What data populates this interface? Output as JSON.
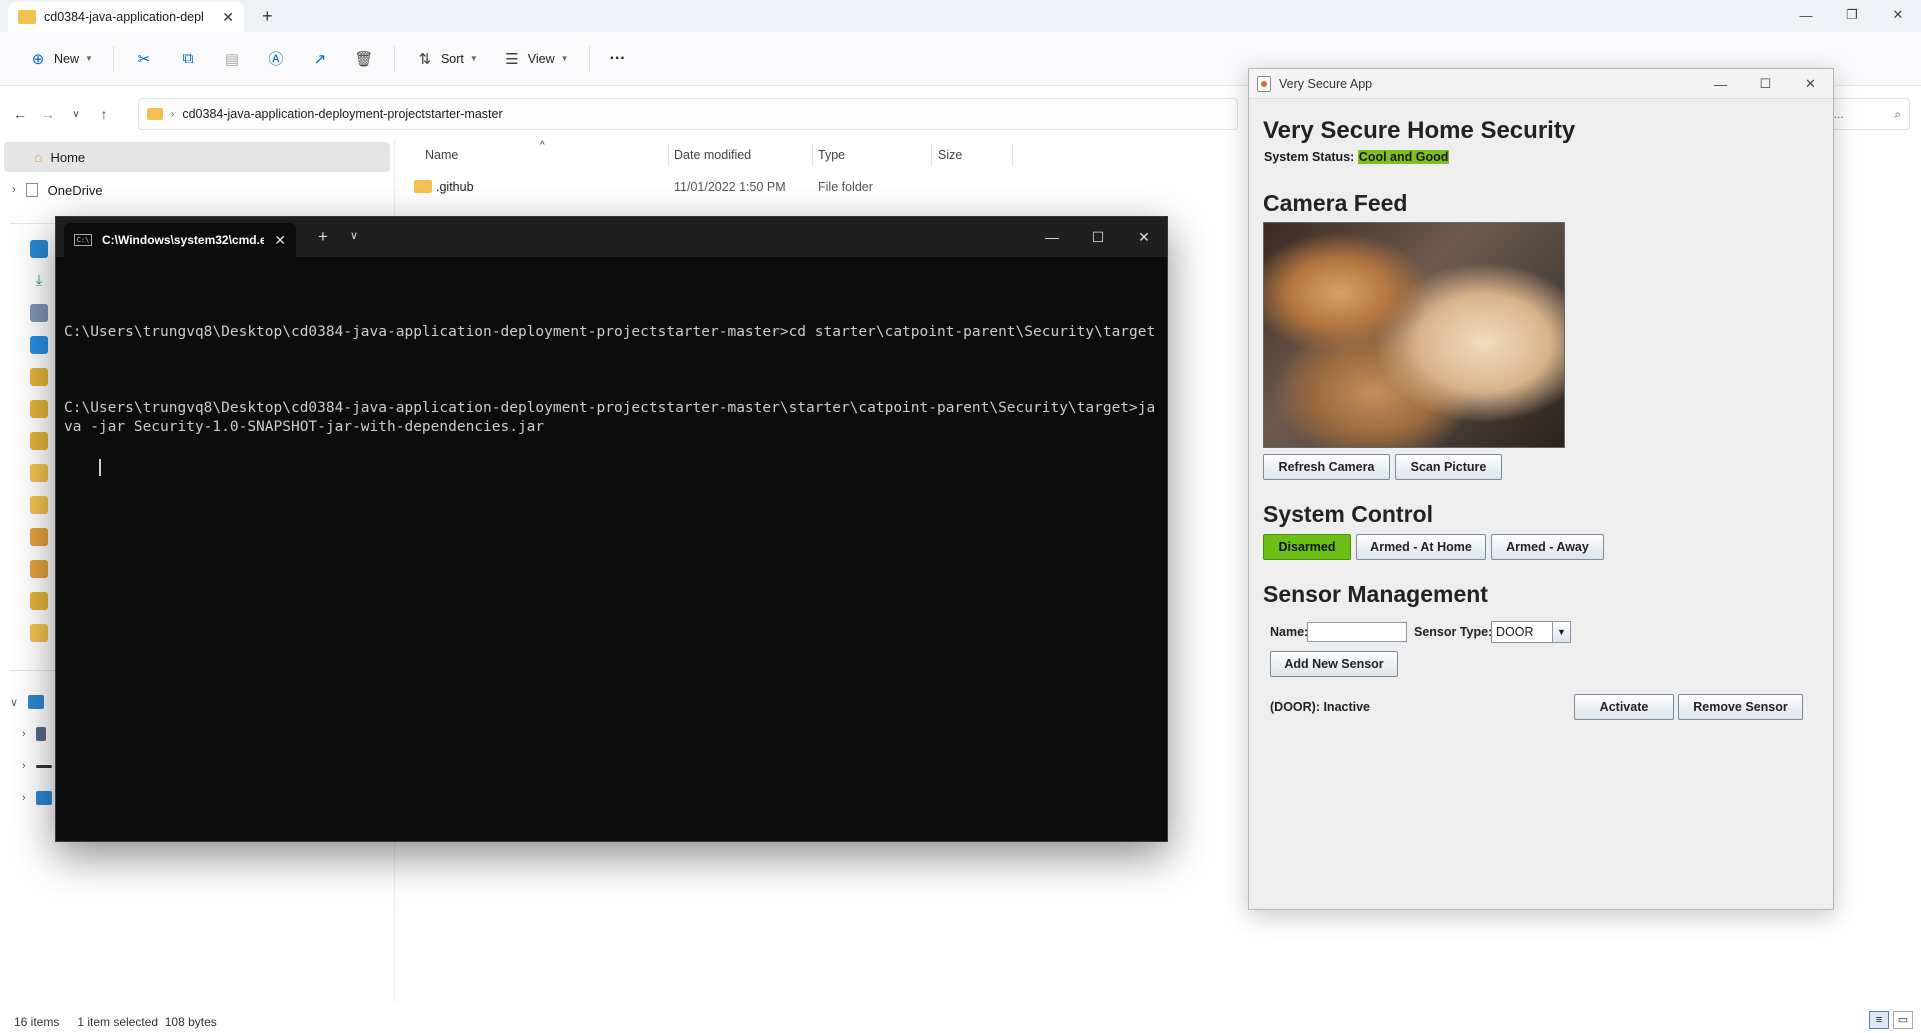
{
  "explorer": {
    "tab_title": "cd0384-java-application-depl",
    "toolbar": {
      "new_label": "New",
      "sort_label": "Sort",
      "view_label": "View",
      "more_label": "···"
    },
    "address_path": "cd0384-java-application-deployment-projectstarter-master",
    "search_placeholder": "plica...",
    "nav": {
      "home_label": "Home",
      "onedrive_label": "OneDrive"
    },
    "columns": {
      "name": "Name",
      "date_modified": "Date modified",
      "type": "Type",
      "size": "Size"
    },
    "rows": [
      {
        "name": ".github",
        "date": "11/01/2022 1:50 PM",
        "type": "File folder"
      }
    ],
    "status": {
      "items": "16 items",
      "selected": "1 item selected",
      "size": "108 bytes"
    }
  },
  "cmd": {
    "tab_title": "C:\\Windows\\system32\\cmd.e:",
    "lines": [
      "C:\\Users\\trungvq8\\Desktop\\cd0384-java-application-deployment-projectstarter-master>cd starter\\catpoint-parent\\Security\\target",
      "C:\\Users\\trungvq8\\Desktop\\cd0384-java-application-deployment-projectstarter-master\\starter\\catpoint-parent\\Security\\target>java -jar Security-1.0-SNAPSHOT-jar-with-dependencies.jar"
    ]
  },
  "app": {
    "window_title": "Very Secure App",
    "heading": "Very Secure Home Security",
    "status_label": "System Status:",
    "status_value": "Cool and Good",
    "status_color": "#7ec01e",
    "camera_heading": "Camera Feed",
    "refresh_camera": "Refresh Camera",
    "scan_picture": "Scan Picture",
    "control_heading": "System Control",
    "disarmed": "Disarmed",
    "armed_home": "Armed - At Home",
    "armed_away": "Armed - Away",
    "active_color": "#6cc015",
    "sensor_heading": "Sensor Management",
    "name_label": "Name:",
    "name_value": "",
    "sensor_type_label": "Sensor Type:",
    "sensor_type_value": "DOOR",
    "add_sensor": "Add New Sensor",
    "sensors": [
      {
        "label": "(DOOR): Inactive",
        "activate": "Activate",
        "remove": "Remove Sensor"
      }
    ]
  }
}
